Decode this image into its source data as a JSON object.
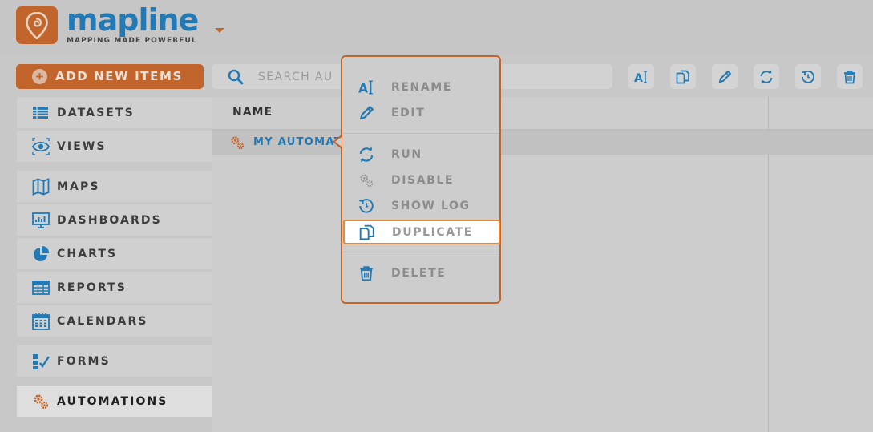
{
  "header": {
    "logo_word": "mapline",
    "logo_tagline": "MAPPING MADE POWERFUL"
  },
  "toolbar": {
    "add_label": "ADD NEW ITEMS",
    "search_placeholder": "SEARCH AU",
    "tools": [
      "rename-icon",
      "duplicate-icon",
      "edit-icon",
      "run-icon",
      "show-log-icon",
      "delete-icon"
    ]
  },
  "sidebar": {
    "items": [
      {
        "label": "DATASETS",
        "icon": "dataset-icon"
      },
      {
        "label": "VIEWS",
        "icon": "eye-icon"
      },
      {
        "label": "MAPS",
        "icon": "map-icon"
      },
      {
        "label": "DASHBOARDS",
        "icon": "dashboard-icon"
      },
      {
        "label": "CHARTS",
        "icon": "pie-chart-icon"
      },
      {
        "label": "REPORTS",
        "icon": "report-icon"
      },
      {
        "label": "CALENDARS",
        "icon": "calendar-icon"
      },
      {
        "label": "FORMS",
        "icon": "form-icon"
      },
      {
        "label": "AUTOMATIONS",
        "icon": "gears-icon"
      }
    ]
  },
  "table": {
    "column_name": "NAME",
    "rows": [
      {
        "name": "MY AUTOMAT"
      }
    ]
  },
  "context_menu": {
    "items": [
      {
        "label": "RENAME",
        "icon": "rename-icon"
      },
      {
        "label": "EDIT",
        "icon": "edit-icon"
      },
      {
        "label": "RUN",
        "icon": "run-icon"
      },
      {
        "label": "DISABLE",
        "icon": "disable-icon"
      },
      {
        "label": "SHOW LOG",
        "icon": "show-log-icon"
      },
      {
        "label": "DUPLICATE",
        "icon": "duplicate-icon"
      },
      {
        "label": "DELETE",
        "icon": "delete-icon"
      }
    ]
  },
  "colors": {
    "brand_orange": "#c1652d",
    "brand_blue": "#217ab5",
    "overlay_gray": "#c8c8c8"
  }
}
